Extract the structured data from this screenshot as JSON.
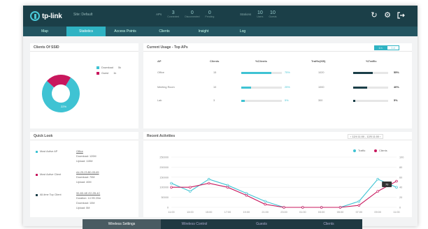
{
  "header": {
    "logo": "tp-link",
    "site": "Site: Default",
    "aps": {
      "title": "APs",
      "stats": [
        {
          "num": "3",
          "label": "Connected"
        },
        {
          "num": "0",
          "label": "Disconnected"
        },
        {
          "num": "0",
          "label": "Pending"
        }
      ]
    },
    "stations": {
      "title": "Stations",
      "stats": [
        {
          "num": "10",
          "label": "Users"
        },
        {
          "num": "10",
          "label": "Guests"
        }
      ]
    },
    "icons": [
      "refresh-icon",
      "gear-icon",
      "logout-icon"
    ]
  },
  "nav": [
    "Map",
    "Statistics",
    "Access Points",
    "Clients",
    "Insight",
    "Log"
  ],
  "nav_active": 1,
  "clients_panel": {
    "title": "Clients Of SSID",
    "legend": [
      {
        "label": "Download",
        "value": "5k",
        "color": "#3fc3d3"
      },
      {
        "label": "Guest",
        "value": "1k",
        "color": "#c8175d"
      }
    ],
    "slices": [
      {
        "pct": "78%",
        "value": 78,
        "color": "#3fc3d3"
      },
      {
        "pct": "22%",
        "value": 22,
        "color": "#c8175d"
      }
    ]
  },
  "usage_panel": {
    "title": "Current Usage - Top APs",
    "toggle": [
      "1 h",
      "1 d"
    ],
    "headers": [
      "AP",
      "Clients",
      "%Clients",
      "Traffic(KB)",
      "%Traffic"
    ],
    "rows": [
      {
        "ap": "Office",
        "clients": "15",
        "pct_clients": "75%",
        "client_fraction": 0.75,
        "traffic": "1020",
        "pct_traffic": "55%",
        "traffic_fraction": 0.55
      },
      {
        "ap": "Meeting Room",
        "clients": "10",
        "pct_clients": "25%",
        "client_fraction": 0.25,
        "traffic": "1000",
        "pct_traffic": "40%",
        "traffic_fraction": 0.4
      },
      {
        "ap": "Lab",
        "clients": "3",
        "pct_clients": "5%",
        "client_fraction": 0.05,
        "traffic": "300",
        "pct_traffic": "5%",
        "traffic_fraction": 0.05
      }
    ]
  },
  "quick_look": {
    "title": "Quick Look",
    "items": [
      {
        "label": "Most Active AP",
        "color": "#3fc3d3",
        "lines": [
          "Office",
          "Download: 120M",
          "Upload: 115M"
        ]
      },
      {
        "label": "Most Active Client",
        "color": "#c8175d",
        "lines": [
          "A4-25-23-B0-05-65",
          "Download: 70M",
          "Upload: 40M"
        ]
      },
      {
        "label": "All-time Top Client",
        "color": "#1b3f48",
        "lines": [
          "90-8D-6E-E2-2B-4C",
          "Duration: 14 H5 20m",
          "Download: 10M",
          "Upload: 5M"
        ]
      }
    ]
  },
  "activities": {
    "title": "Recent Activities",
    "date_range": "12/4 11:00 - 12/5 11:00",
    "tooltip": "70",
    "chart_data": {
      "type": "line",
      "x": [
        "11:00",
        "13:00",
        "15:00",
        "17:00",
        "19:00",
        "21:00",
        "23:00",
        "01:00",
        "03:00",
        "05:00",
        "07:00",
        "09:00",
        "11:00"
      ],
      "series": [
        {
          "name": "Traffic",
          "color": "#3fc3d3",
          "values": [
            120,
            80,
            140,
            110,
            70,
            30,
            0,
            0,
            0,
            0,
            30,
            140,
            100
          ]
        },
        {
          "name": "Clients",
          "color": "#c8175d",
          "values": [
            100,
            100,
            120,
            100,
            60,
            15,
            0,
            0,
            0,
            0,
            10,
            80,
            130
          ]
        }
      ],
      "y_ticks": [
        "250000",
        "200000",
        "150000",
        "100000",
        "50000",
        "0"
      ],
      "right_ticks": [
        "100",
        "80",
        "60",
        "40",
        "20",
        "0"
      ],
      "ylim": [
        0,
        250
      ]
    }
  },
  "dock": {
    "tabs": [
      "Wireless Settings",
      "Wireless Control",
      "Guests",
      "Clients"
    ],
    "active": 0
  }
}
